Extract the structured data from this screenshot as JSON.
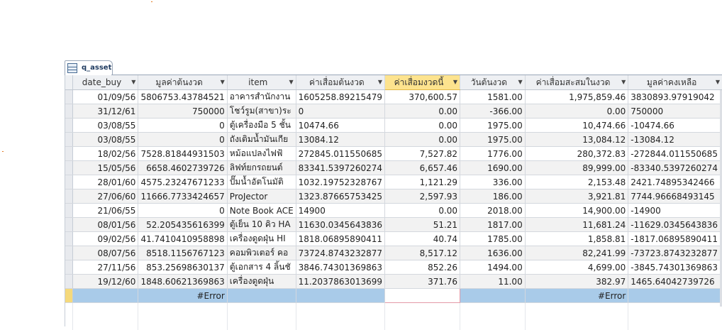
{
  "tab": {
    "label": "q_asset",
    "icon": "query-icon"
  },
  "columns": [
    "date_buy",
    "มูลค่าต้นงวด",
    "item",
    "ค่าเสื่อมต้นงวด",
    "ค่าเสื่อมงวดนี้",
    "วันต้นงวด",
    "ค่าเสื่อมสะสมในงวด",
    "มูลค่าคงเหลือ"
  ],
  "selected_column_index": 4,
  "rows": [
    [
      "01/09/56",
      "5806753.43784521",
      "อาคารสำนักงาน",
      "1605258.89215479",
      "370,600.57",
      "1581.00",
      "1,975,859.46",
      "3830893.97919042"
    ],
    [
      "31/12/61",
      "750000",
      "โชว์รูม(สาขา)ระ",
      "0",
      "0.00",
      "-366.00",
      "0.00",
      "750000"
    ],
    [
      "03/08/55",
      "0",
      "ตู้เครื่องมือ 5 ชั้น",
      "10474.66",
      "0.00",
      "1975.00",
      "10,474.66",
      "-10474.66"
    ],
    [
      "03/08/55",
      "0",
      "ถังเติมน้ำมันเกีย",
      "13084.12",
      "0.00",
      "1975.00",
      "13,084.12",
      "-13084.12"
    ],
    [
      "18/02/56",
      "7528.81844931503",
      "หม้อแปลงไฟฟ้",
      "272845.011550685",
      "7,527.82",
      "1776.00",
      "280,372.83",
      "-272844.011550685"
    ],
    [
      "15/05/56",
      "6658.4602739726",
      "ลิฟท์ยกรถยนต์",
      "83341.5397260274",
      "6,657.46",
      "1690.00",
      "89,999.00",
      "-83340.5397260274"
    ],
    [
      "28/01/60",
      "4575.23247671233",
      "ปั๊มน้ำอัตโนมัติ",
      "1032.19752328767",
      "1,121.29",
      "336.00",
      "2,153.48",
      "2421.74895342466"
    ],
    [
      "27/06/60",
      "11666.7733424657",
      "ProJector",
      "1323.87665753425",
      "2,597.93",
      "186.00",
      "3,921.81",
      "7744.96668493145"
    ],
    [
      "21/06/55",
      "0",
      "Note Book ACE",
      "14900",
      "0.00",
      "2018.00",
      "14,900.00",
      "-14900"
    ],
    [
      "08/01/56",
      "52.205435616399",
      "ตู้เย็น 10 คิว HA",
      "11630.0345643836",
      "51.21",
      "1817.00",
      "11,681.24",
      "-11629.0345643836"
    ],
    [
      "09/02/56",
      "41.7410410958898",
      "เครื่องดูดฝุ่น HI",
      "1818.06895890411",
      "40.74",
      "1785.00",
      "1,858.81",
      "-1817.06895890411"
    ],
    [
      "08/07/56",
      "8518.1156767123",
      "คอมพิวเตอร์ คอ",
      "73724.8743232877",
      "8,517.12",
      "1636.00",
      "82,241.99",
      "-73723.8743232877"
    ],
    [
      "27/11/56",
      "853.25698630137",
      "ตู้เอกสาร 4 ลิ้นชั",
      "3846.74301369863",
      "852.26",
      "1494.00",
      "4,699.00",
      "-3845.74301369863"
    ],
    [
      "19/12/60",
      "1848.60621369863",
      "เครื่องดูดฝุ่น",
      "11.2037863013699",
      "371.76",
      "11.00",
      "382.97",
      "1465.64042739726"
    ]
  ],
  "new_row": [
    "",
    "#Error",
    "",
    "",
    "",
    "",
    "#Error",
    ""
  ],
  "colors": {
    "header_bg": "#eef0f3",
    "selected_header_bg": "#fde38e",
    "new_row_bg": "#a9cbe9",
    "new_row_selector": "#f5d97b"
  }
}
